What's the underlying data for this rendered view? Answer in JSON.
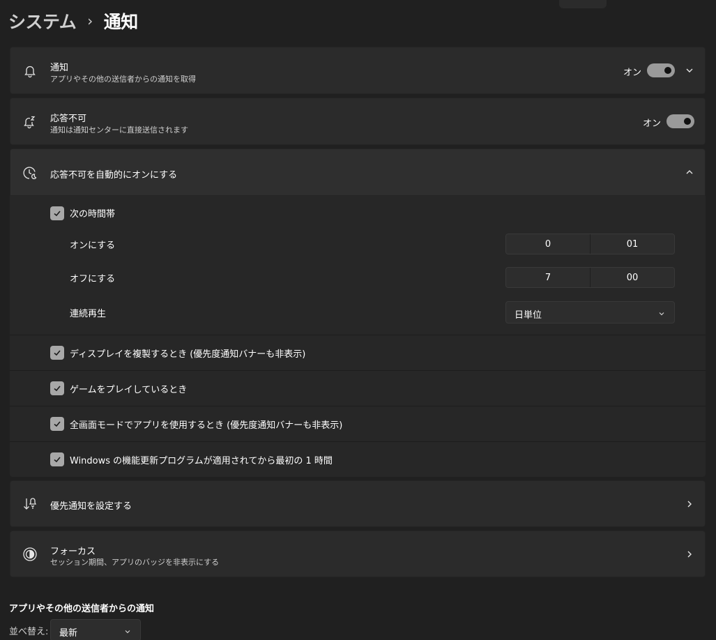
{
  "breadcrumb": {
    "parent": "システム",
    "separator": "›",
    "current": "通知"
  },
  "notifications": {
    "title": "通知",
    "subtitle": "アプリやその他の送信者からの通知を取得",
    "toggle_label": "オン",
    "icon": "bell-icon"
  },
  "dnd": {
    "title": "応答不可",
    "subtitle": "通知は通知センターに直接送信されます",
    "toggle_label": "オン",
    "icon": "bell-snooze-icon"
  },
  "auto_dnd": {
    "title": "応答不可を自動的にオンにする",
    "icon": "clock-moon-icon",
    "schedule": {
      "label": "次の時間帯",
      "turn_on_label": "オンにする",
      "turn_on_hour": "0",
      "turn_on_minute": "01",
      "turn_off_label": "オフにする",
      "turn_off_hour": "7",
      "turn_off_minute": "00",
      "repeat_label": "連続再生",
      "repeat_value": "日単位"
    },
    "options": [
      {
        "label": "ディスプレイを複製するとき (優先度通知バナーも非表示)",
        "checked": true
      },
      {
        "label": "ゲームをプレイしているとき",
        "checked": true
      },
      {
        "label": "全画面モードでアプリを使用するとき (優先度通知バナーも非表示)",
        "checked": true
      },
      {
        "label": "Windows の機能更新プログラムが適用されてから最初の 1 時間",
        "checked": true
      }
    ]
  },
  "priority": {
    "title": "優先通知を設定する",
    "icon": "priority-sort-icon"
  },
  "focus": {
    "title": "フォーカス",
    "subtitle": "セッション期間、アプリのバッジを非表示にする",
    "icon": "focus-icon"
  },
  "senders_section": {
    "title": "アプリやその他の送信者からの通知",
    "sort_label": "並べ替え:",
    "sort_value": "最新"
  },
  "colors": {
    "background": "#202020",
    "card": "#2b2b2b",
    "toggle_on": "#9a9a9a",
    "checkbox": "#a8a8a8"
  }
}
